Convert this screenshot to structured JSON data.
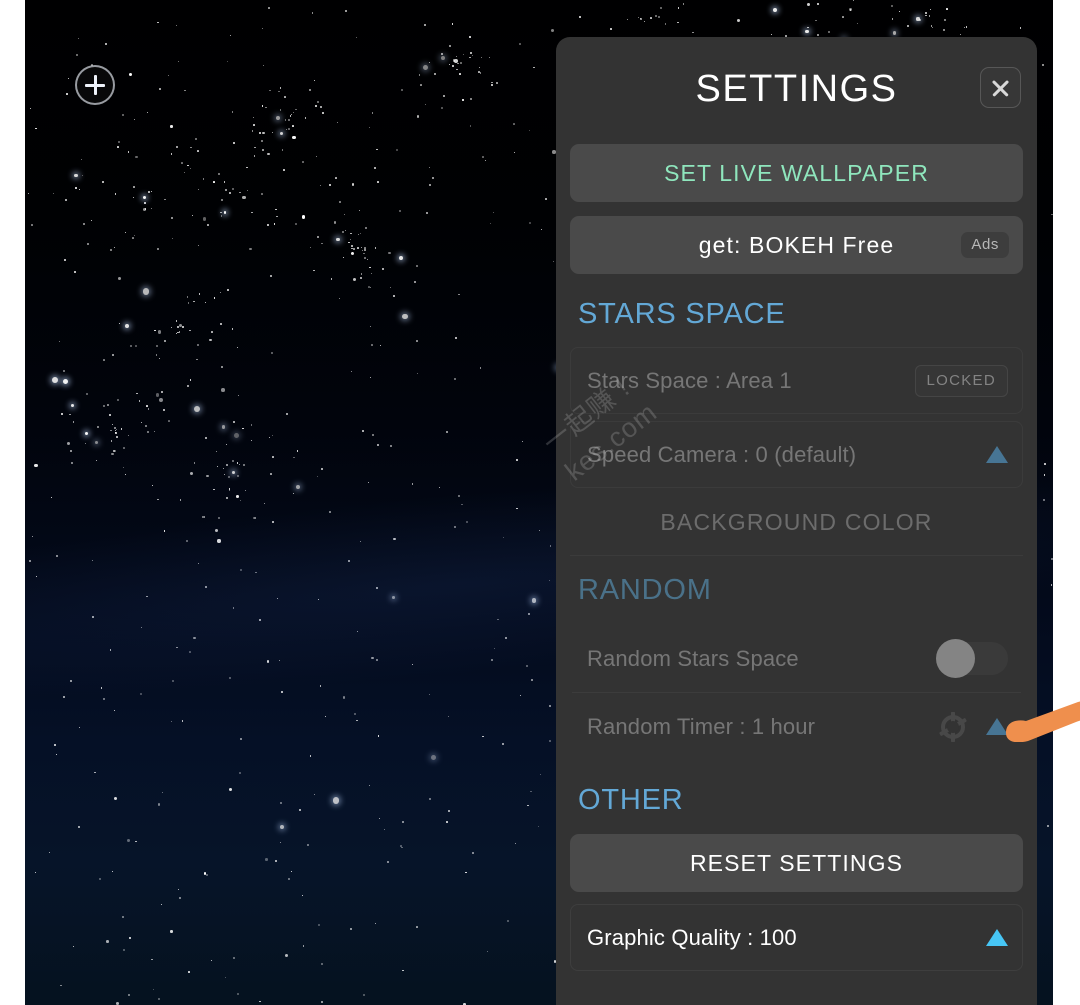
{
  "app": {
    "wallpaper_name": "stars-space-live-wallpaper"
  },
  "preview": {
    "add_button_icon": "plus-circle-icon"
  },
  "panel": {
    "title": "SETTINGS",
    "close_icon": "close-icon",
    "cta_primary": "SET LIVE WALLPAPER",
    "promo": {
      "label": "get: BOKEH Free",
      "badge": "Ads"
    },
    "sections": [
      {
        "title": "STARS SPACE",
        "rows": [
          {
            "label": "Stars Space : Area 1",
            "badge": "LOCKED",
            "state": "locked"
          },
          {
            "label": "Speed Camera : 0 (default)",
            "control": "triangle-up-icon",
            "state": "locked"
          }
        ],
        "action": "BACKGROUND COLOR"
      },
      {
        "title": "RANDOM",
        "rows": [
          {
            "label": "Random Stars Space",
            "control": "toggle-switch",
            "toggle_on": false,
            "state": "locked"
          },
          {
            "label": "Random Timer :  1 hour",
            "control": "gear-icon",
            "control2": "triangle-up-icon",
            "state": "locked"
          }
        ]
      },
      {
        "title": "OTHER",
        "button": "RESET SETTINGS",
        "rows": [
          {
            "label": "Graphic Quality : 100",
            "control": "triangle-up-icon",
            "state": "active"
          }
        ]
      }
    ]
  },
  "watermark": {
    "line1": "一起赚 !",
    "line2": "kes.com"
  },
  "colors": {
    "panel_bg": "#333333",
    "section_heading": "#63a8d6",
    "cta_green": "#8fe6bd",
    "triangle_bright": "#47c6f5",
    "triangle_dim": "#4d88b0",
    "finger": "#ef8f4d"
  }
}
